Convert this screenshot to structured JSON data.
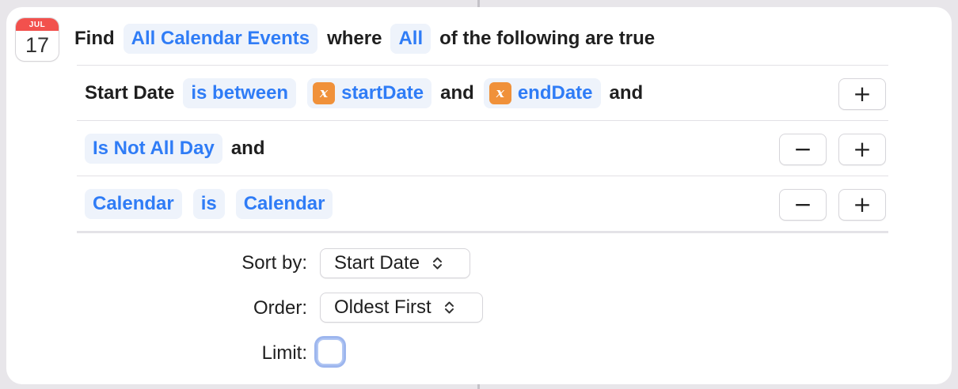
{
  "calendar_icon": {
    "month": "JUL",
    "day": "17"
  },
  "header": {
    "find": "Find",
    "entity": "All Calendar Events",
    "where": "where",
    "quantifier": "All",
    "suffix": "of the following are true"
  },
  "filters": [
    {
      "property": "Start Date",
      "operator": "is between",
      "value1": "startDate",
      "and1": "and",
      "value2": "endDate",
      "and2": "and",
      "var_glyph": "x"
    },
    {
      "property": "Is Not All Day",
      "conj": "and"
    },
    {
      "property": "Calendar",
      "operator": "is",
      "value": "Calendar"
    }
  ],
  "buttons": {
    "add": "+",
    "remove": "−"
  },
  "options": {
    "sort_label": "Sort by:",
    "sort_value": "Start Date",
    "order_label": "Order:",
    "order_value": "Oldest First",
    "limit_label": "Limit:",
    "limit_checked": false
  },
  "colors": {
    "accent": "#2f7cf6",
    "variable_badge": "#f0913a",
    "calendar_red": "#f2514d"
  }
}
